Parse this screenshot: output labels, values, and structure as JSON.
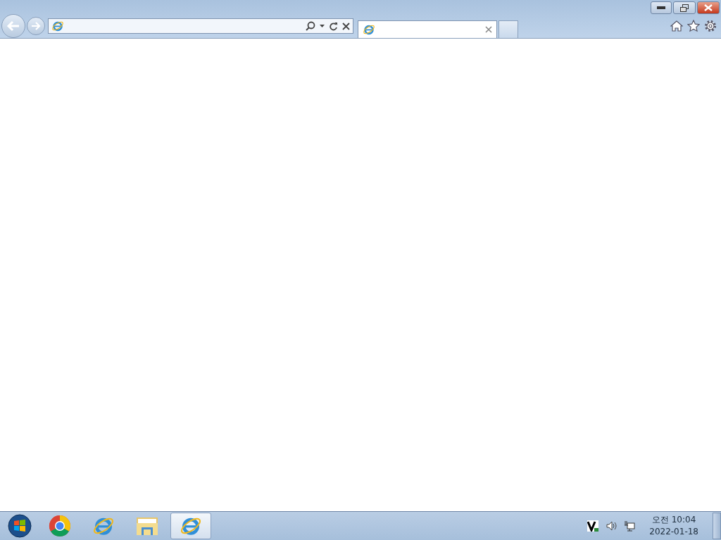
{
  "browser": {
    "tabs": [
      {
        "selected": true
      }
    ]
  },
  "taskbar": {
    "apps": [
      {
        "kind": "chrome",
        "selected": false
      },
      {
        "kind": "ie",
        "selected": false
      },
      {
        "kind": "folder",
        "selected": false
      },
      {
        "kind": "ie",
        "selected": true
      }
    ],
    "clock": {
      "time": "오전 10:04",
      "date": "2022-01-18"
    }
  }
}
